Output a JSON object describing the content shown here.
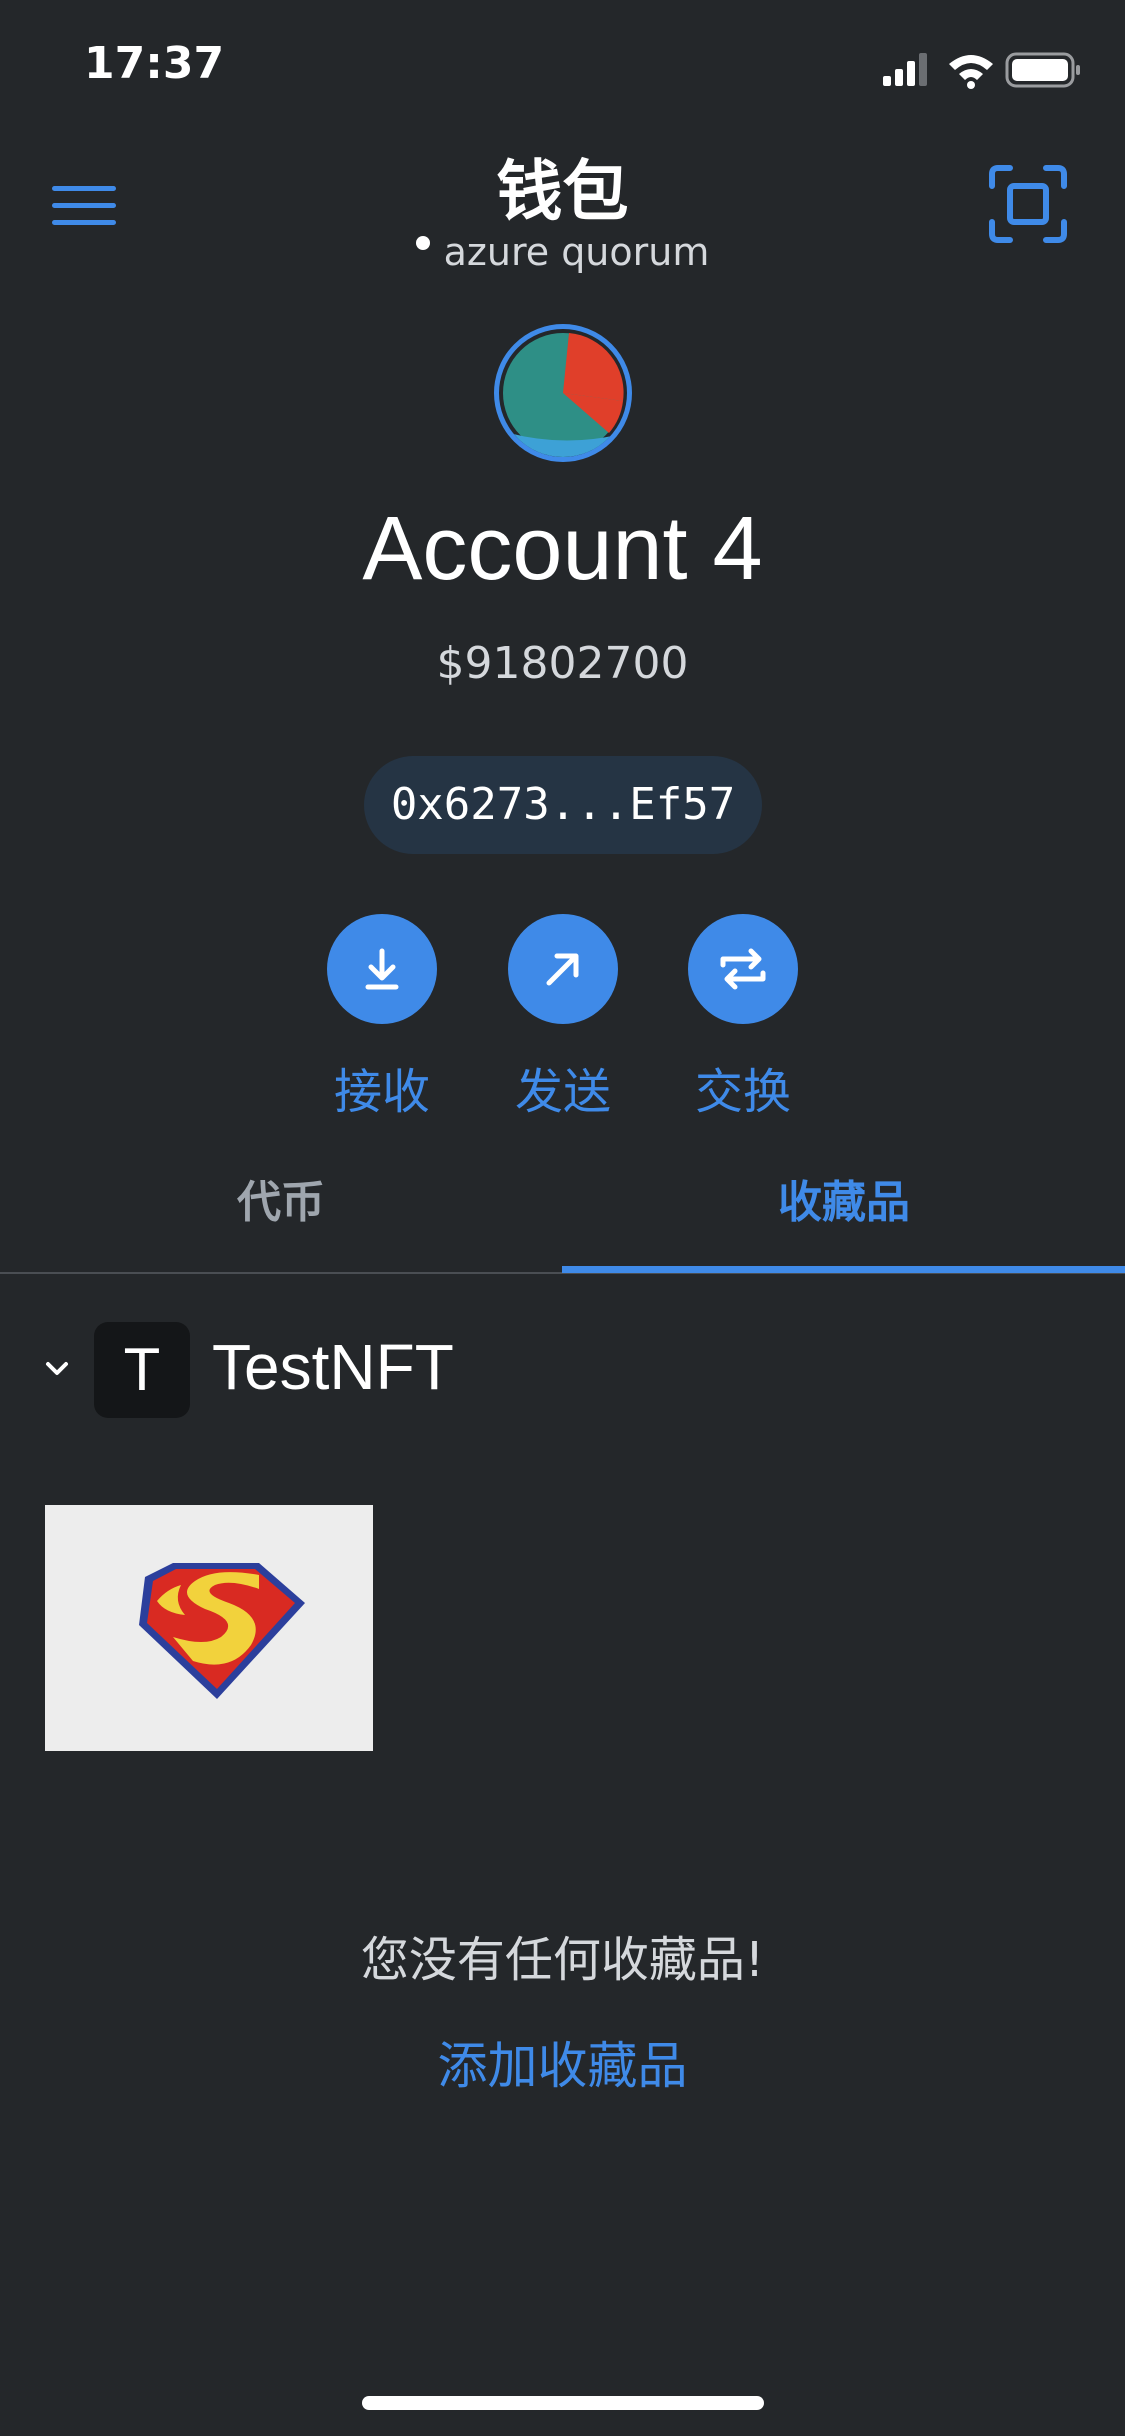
{
  "status_bar": {
    "time": "17:37",
    "icons": [
      "cellular-signal-icon",
      "wifi-icon",
      "battery-icon"
    ]
  },
  "header": {
    "title": "钱包",
    "network": "azure quorum",
    "left_icon": "hamburger-menu-icon",
    "right_icon": "qr-scan-icon"
  },
  "account": {
    "name": "Account 4",
    "balance": "$91802700",
    "address": "0x6273...Ef57"
  },
  "actions": [
    {
      "label": "接收",
      "icon": "receive-download-icon"
    },
    {
      "label": "发送",
      "icon": "send-arrow-icon"
    },
    {
      "label": "交换",
      "icon": "swap-arrows-icon"
    }
  ],
  "tabs": [
    {
      "label": "代币",
      "active": false
    },
    {
      "label": "收藏品",
      "active": true
    }
  ],
  "collection": {
    "badge_letter": "T",
    "name": "TestNFT",
    "thumbnail_icon": "superman-logo-image"
  },
  "empty_state": {
    "message": "您没有任何收藏品!",
    "link": "添加收藏品"
  },
  "colors": {
    "background": "#24272a",
    "accent": "#3f8ae8",
    "pill": "#253444"
  }
}
